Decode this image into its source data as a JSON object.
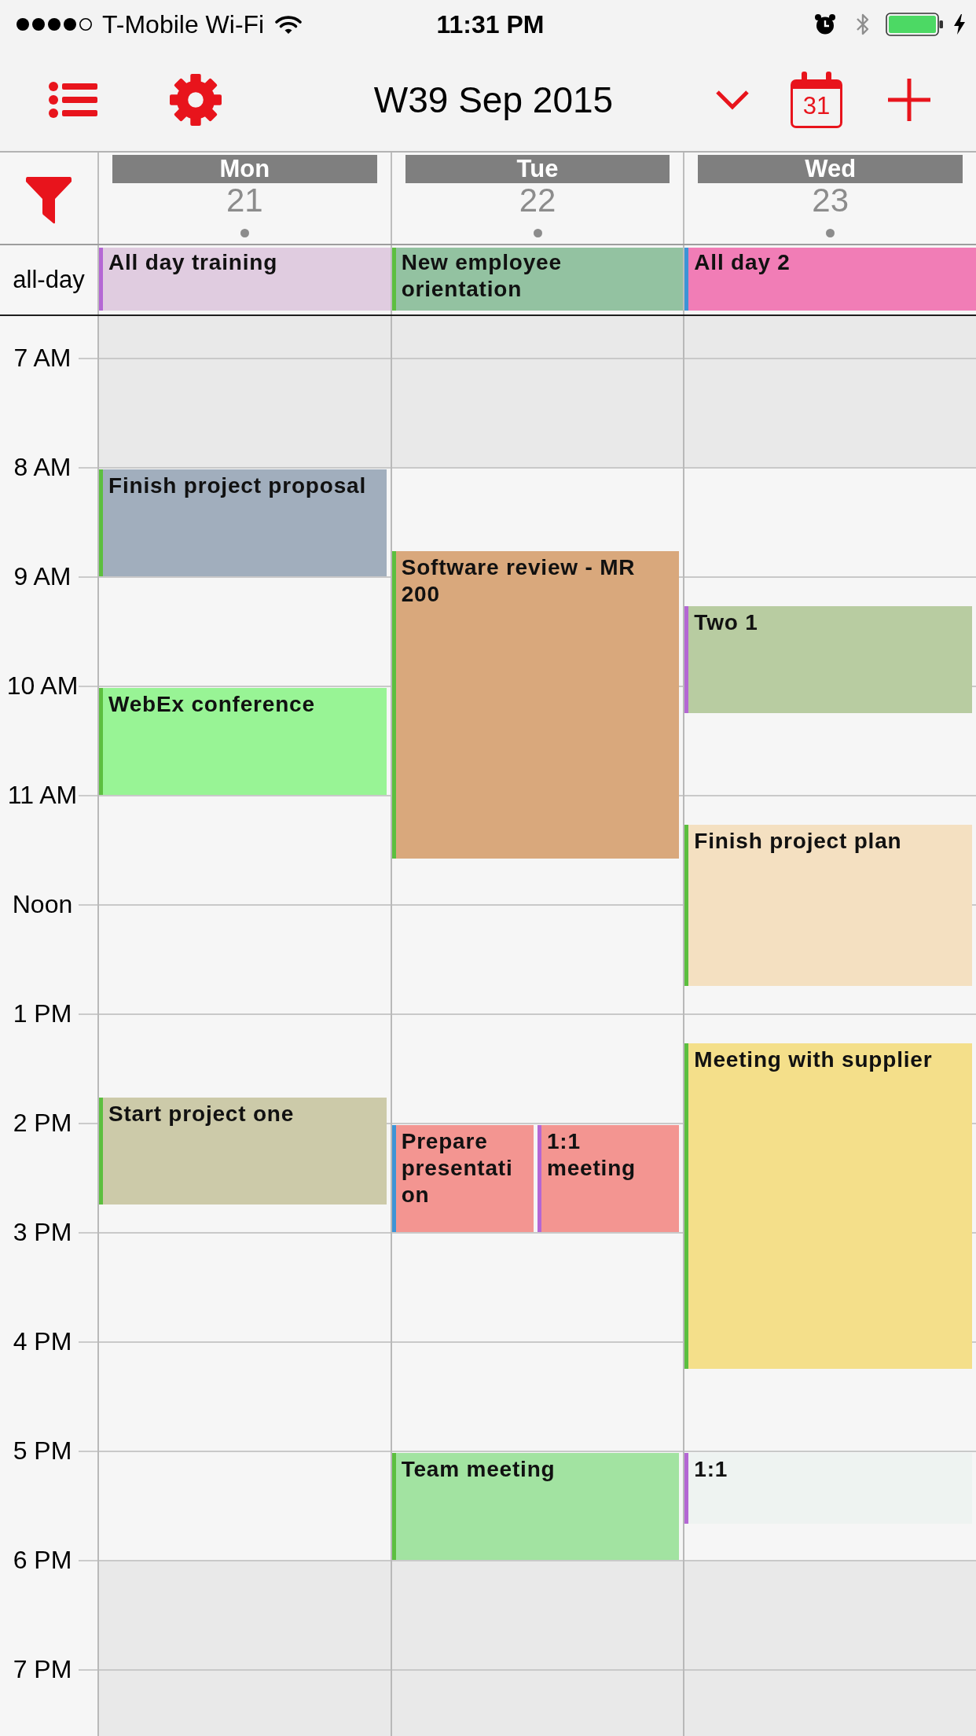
{
  "status_bar": {
    "carrier": "T-Mobile Wi-Fi",
    "time": "11:31 PM"
  },
  "toolbar": {
    "title": "W39 Sep 2015",
    "today": "31"
  },
  "all_day_label": "all-day",
  "days": [
    {
      "name": "Mon",
      "date": "21",
      "has_events": true,
      "all_day": [
        {
          "title": "All day training",
          "color": "#e0cce0",
          "calendar": {
            "color": "#b467d4"
          }
        }
      ],
      "events": [
        {
          "title": "Finish project proposal",
          "color": "#a1aebd",
          "calendar": {
            "color": "#5cbf3f"
          }
        },
        {
          "title": "WebEx conference",
          "color": "#98f495",
          "calendar": {
            "color": "#5cbf3f"
          }
        },
        {
          "title": "Start project one",
          "color": "#cccaa9",
          "calendar": {
            "color": "#5cbf3f"
          }
        }
      ]
    },
    {
      "name": "Tue",
      "date": "22",
      "has_events": true,
      "all_day": [
        {
          "title": "New employee orientation",
          "color": "#93c2a1",
          "calendar": {
            "color": "#5cbf3f"
          }
        }
      ],
      "events": [
        {
          "title": "Software review - MR 200",
          "color": "#d9a87c",
          "calendar": {
            "color": "#5cbf3f"
          }
        },
        {
          "title": "Prepare presentation",
          "color": "#f39591",
          "calendar": {
            "color": "#3d94d6"
          }
        },
        {
          "title": "1:1 meeting",
          "color": "#f39591",
          "calendar": {
            "color": "#b467d4"
          }
        },
        {
          "title": "Team meeting",
          "color": "#a2e3a1",
          "calendar": {
            "color": "#5cbf3f"
          }
        }
      ]
    },
    {
      "name": "Wed",
      "date": "23",
      "has_events": true,
      "all_day": [
        {
          "title": "All day 2",
          "color": "#f17db6",
          "calendar": {
            "color": "#3d94d6"
          }
        }
      ],
      "events": [
        {
          "title": "Two 1",
          "color": "#b8cca1",
          "calendar": {
            "color": "#b467d4"
          }
        },
        {
          "title": "Finish project plan",
          "color": "#f4e0c1",
          "calendar": {
            "color": "#5cbf3f"
          }
        },
        {
          "title": "Meeting with supplier",
          "color": "#f4df8a",
          "calendar": {
            "color": "#5cbf3f"
          }
        },
        {
          "title": "1:1",
          "color": "#eef3f1",
          "calendar": {
            "color": "#b467d4"
          }
        }
      ]
    }
  ],
  "hours": [
    {
      "label": "7 AM",
      "kind": "off"
    },
    {
      "label": "8 AM",
      "kind": "work"
    },
    {
      "label": "9 AM",
      "kind": "work"
    },
    {
      "label": "10 AM",
      "kind": "work"
    },
    {
      "label": "11 AM",
      "kind": "work"
    },
    {
      "label": "Noon",
      "kind": "work"
    },
    {
      "label": "1 PM",
      "kind": "work"
    },
    {
      "label": "2 PM",
      "kind": "work"
    },
    {
      "label": "3 PM",
      "kind": "work"
    },
    {
      "label": "4 PM",
      "kind": "work"
    },
    {
      "label": "5 PM",
      "kind": "work"
    },
    {
      "label": "6 PM",
      "kind": "off"
    },
    {
      "label": "7 PM",
      "kind": "off"
    }
  ]
}
